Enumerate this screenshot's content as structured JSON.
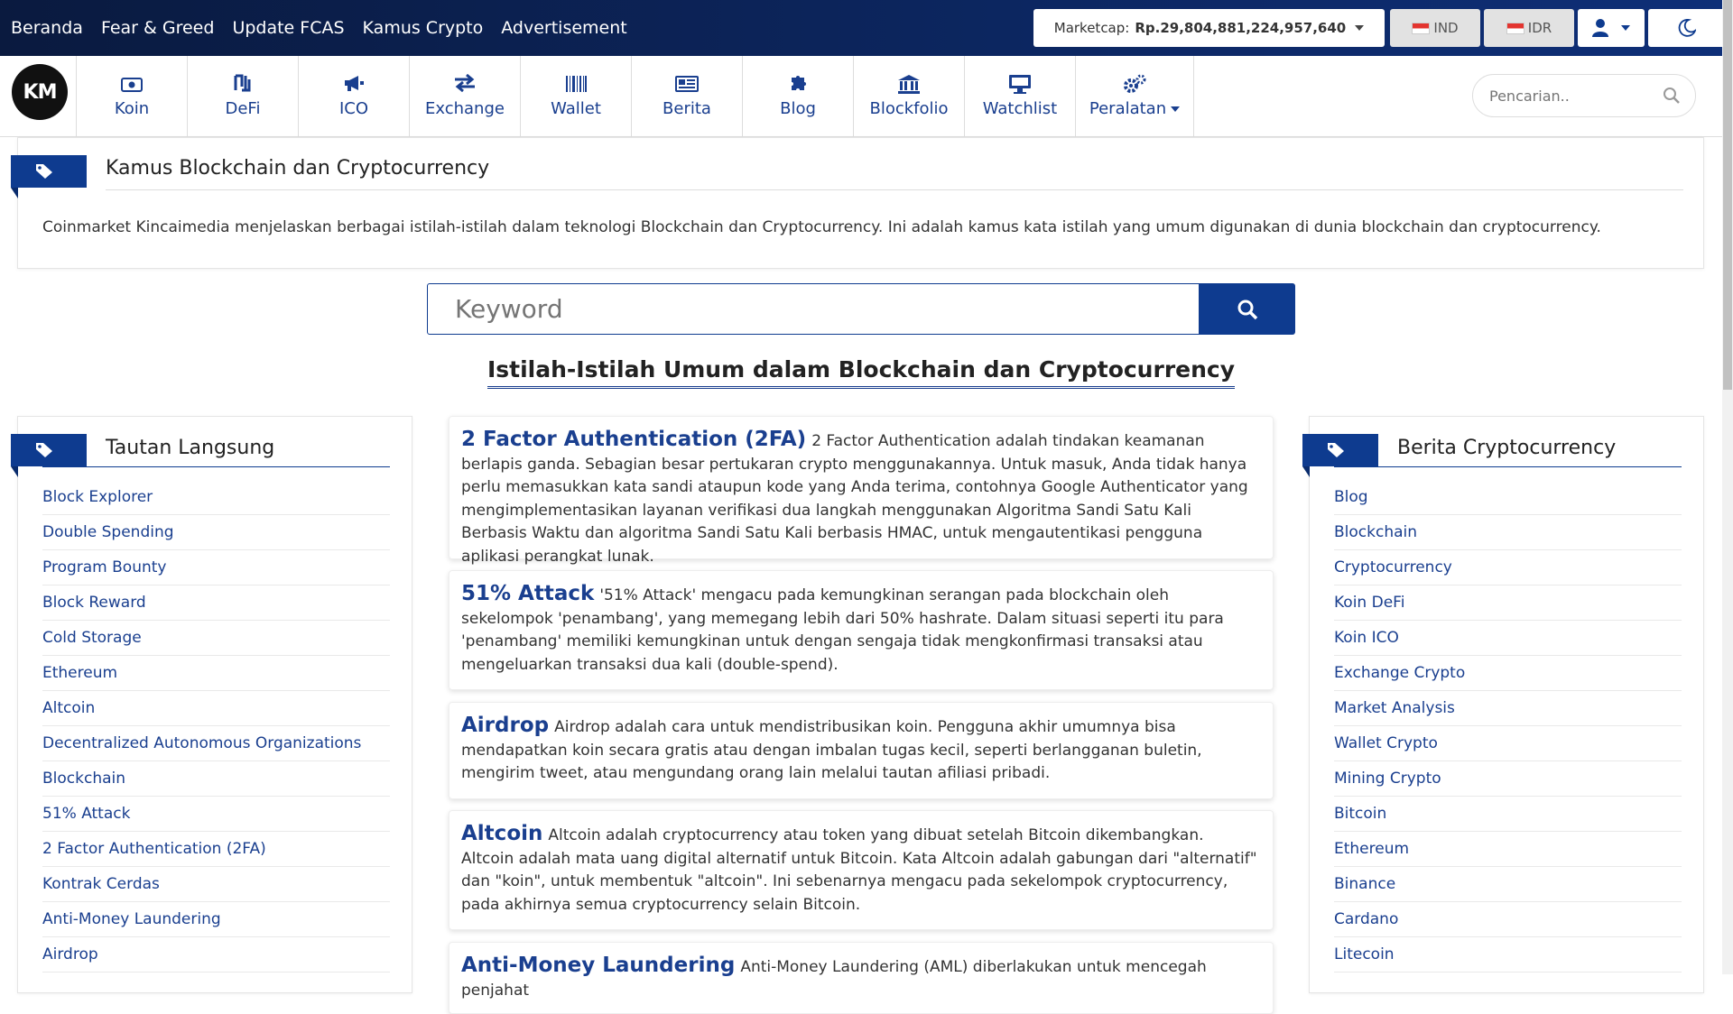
{
  "topbar": {
    "nav": [
      "Beranda",
      "Fear & Greed",
      "Update FCAS",
      "Kamus Crypto",
      "Advertisement"
    ],
    "marketcap_label": "Marketcap:",
    "marketcap_value": "Rp.29,804,881,224,957,640",
    "lang": "IND",
    "currency": "IDR",
    "colors": {
      "bar_start": "#0a1a3f",
      "bar_end": "#0e2f78",
      "accent": "#0e3b8f",
      "link": "#1a3f8f"
    }
  },
  "navbar": {
    "logo": "KM",
    "items": [
      {
        "label": "Koin",
        "icon": "money-bill-icon"
      },
      {
        "label": "DeFi",
        "icon": "defi-icon"
      },
      {
        "label": "ICO",
        "icon": "bullhorn-icon"
      },
      {
        "label": "Exchange",
        "icon": "exchange-icon"
      },
      {
        "label": "Wallet",
        "icon": "barcode-icon"
      },
      {
        "label": "Berita",
        "icon": "newspaper-icon"
      },
      {
        "label": "Blog",
        "icon": "puzzle-icon"
      },
      {
        "label": "Blockfolio",
        "icon": "bank-icon"
      },
      {
        "label": "Watchlist",
        "icon": "desktop-icon"
      },
      {
        "label": "Peralatan",
        "icon": "gears-icon"
      }
    ],
    "search_placeholder": "Pencarian.."
  },
  "header": {
    "title": "Kamus Blockchain dan Cryptocurrency",
    "description": "Coinmarket Kincaimedia menjelaskan berbagai istilah-istilah dalam teknologi Blockchain dan Cryptocurrency. Ini adalah kamus kata istilah yang umum digunakan di dunia blockchain dan cryptocurrency."
  },
  "keyword": {
    "placeholder": "Keyword"
  },
  "main": {
    "title": "Istilah-Istilah Umum dalam Blockchain dan Cryptocurrency",
    "terms": [
      {
        "term": "2 Factor Authentication (2FA)",
        "desc": "2 Factor Authentication adalah tindakan keamanan berlapis ganda. Sebagian besar pertukaran crypto menggunakannya. Untuk masuk, Anda tidak hanya perlu memasukkan kata sandi ataupun kode yang Anda terima, contohnya Google Authenticator yang mengimplementasikan layanan verifikasi dua langkah menggunakan Algoritma Sandi Satu Kali Berbasis Waktu dan algoritma Sandi Satu Kali berbasis HMAC, untuk mengautentikasi pengguna aplikasi perangkat lunak."
      },
      {
        "term": "51% Attack",
        "desc": "'51% Attack' mengacu pada kemungkinan serangan pada blockchain oleh sekelompok 'penambang', yang memegang lebih dari 50% hashrate. Dalam situasi seperti itu para 'penambang' memiliki kemungkinan untuk dengan sengaja tidak mengkonfirmasi transaksi atau mengeluarkan transaksi dua kali (double-spend)."
      },
      {
        "term": "Airdrop",
        "desc": "Airdrop adalah cara untuk mendistribusikan koin. Pengguna akhir umumnya bisa mendapatkan koin secara gratis atau dengan imbalan tugas kecil, seperti berlangganan buletin, mengirim tweet, atau mengundang orang lain melalui tautan afiliasi pribadi."
      },
      {
        "term": "Altcoin",
        "desc": "Altcoin adalah cryptocurrency atau token yang dibuat setelah Bitcoin dikembangkan. Altcoin adalah mata uang digital alternatif untuk Bitcoin. Kata Altcoin adalah gabungan dari \"alternatif\" dan \"koin\", untuk membentuk \"altcoin\". Ini sebenarnya mengacu pada sekelompok cryptocurrency, pada akhirnya semua cryptocurrency selain Bitcoin."
      },
      {
        "term": "Anti-Money Laundering",
        "desc": "Anti-Money Laundering (AML) diberlakukan untuk mencegah penjahat"
      }
    ]
  },
  "left": {
    "title": "Tautan Langsung",
    "links": [
      "Block Explorer",
      "Double Spending",
      "Program Bounty",
      "Block Reward",
      "Cold Storage",
      "Ethereum",
      "Altcoin",
      "Decentralized Autonomous Organizations",
      "Blockchain",
      "51% Attack",
      "2 Factor Authentication (2FA)",
      "Kontrak Cerdas",
      "Anti-Money Laundering",
      "Airdrop"
    ]
  },
  "right": {
    "title": "Berita Cryptocurrency",
    "links": [
      "Blog",
      "Blockchain",
      "Cryptocurrency",
      "Koin DeFi",
      "Koin ICO",
      "Exchange Crypto",
      "Market Analysis",
      "Wallet Crypto",
      "Mining Crypto",
      "Bitcoin",
      "Ethereum",
      "Binance",
      "Cardano",
      "Litecoin"
    ]
  }
}
